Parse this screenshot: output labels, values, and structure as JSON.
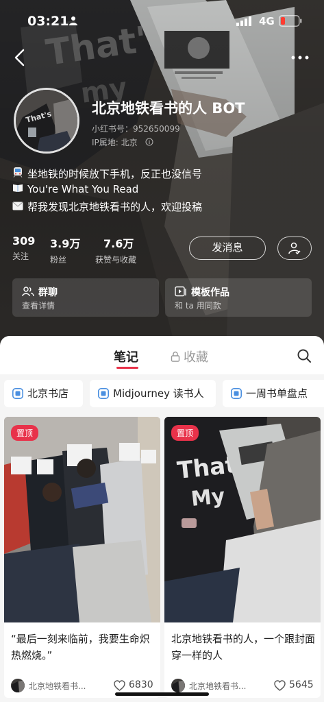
{
  "status": {
    "time": "03:21",
    "network": "4G"
  },
  "profile": {
    "name": "北京地铁看书的人 BOT",
    "id_label": "小红书号：952650099",
    "ip_label": "IP属地: 北京",
    "bio": [
      {
        "icon": "metro-emoji",
        "text": "坐地铁的时候放下手机，反正也没信号"
      },
      {
        "icon": "book-emoji",
        "text": "You're What You Read"
      },
      {
        "icon": "envelope-emoji",
        "text": "帮我发现北京地铁看书的人，欢迎投稿"
      }
    ],
    "stats": [
      {
        "num": "309",
        "label": "关注"
      },
      {
        "num": "3.9万",
        "label": "粉丝"
      },
      {
        "num": "7.6万",
        "label": "获赞与收藏"
      }
    ],
    "message_button": "发消息",
    "cards": [
      {
        "title": "群聊",
        "sub": "查看详情",
        "icon": "group-icon"
      },
      {
        "title": "模板作品",
        "sub": "和 ta 用同款",
        "icon": "template-icon"
      }
    ]
  },
  "tabs": {
    "notes": "笔记",
    "favorites": "收藏"
  },
  "collections": [
    "北京书店",
    "Midjourney 读书人",
    "一周书单盘点"
  ],
  "notes": [
    {
      "pinned": "置顶",
      "title": "“最后一刻来临前，我要生命炽热燃烧。”",
      "author": "北京地铁看书...",
      "likes": "6830"
    },
    {
      "pinned": "置顶",
      "title": "北京地铁看书的人，一个跟封面穿一样的人",
      "author": "北京地铁看书...",
      "likes": "5645"
    }
  ],
  "colors": {
    "accent": "#e8324a",
    "hero_bg": "#3f3c38"
  }
}
